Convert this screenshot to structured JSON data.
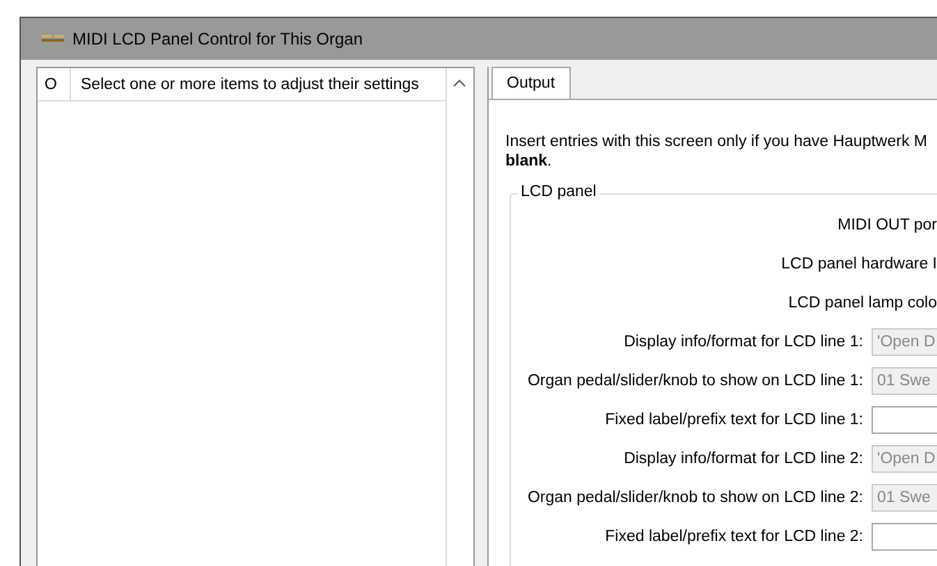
{
  "window": {
    "title": "MIDI LCD Panel Control for This Organ"
  },
  "item_list": {
    "columns": [
      "O",
      "Select one or more items to adjust their settings"
    ]
  },
  "tabs": [
    {
      "label": "Output",
      "selected": true
    }
  ],
  "intro": [
    "Insert entries with this screen only if you have Hauptwerk M",
    "**blank**."
  ],
  "group": {
    "title": "LCD panel",
    "rows": [
      {
        "label": "MIDI OUT por",
        "kind": "cut"
      },
      {
        "label": "LCD panel hardware I",
        "kind": "cut"
      },
      {
        "label": "LCD panel lamp colo",
        "kind": "cut"
      },
      {
        "label": "Display info/format for LCD line 1:",
        "kind": "dropdown",
        "value": "'Open D"
      },
      {
        "label": "Organ pedal/slider/knob to show on LCD line 1:",
        "kind": "dropdown",
        "value": "01 Swe"
      },
      {
        "label": "Fixed label/prefix text for LCD line 1:",
        "kind": "text"
      },
      {
        "label": "Display info/format for LCD line 2:",
        "kind": "dropdown",
        "value": "'Open D"
      },
      {
        "label": "Organ pedal/slider/knob to show on LCD line 2:",
        "kind": "dropdown",
        "value": "01 Swe"
      },
      {
        "label": "Fixed label/prefix text for LCD line 2:",
        "kind": "text"
      }
    ]
  }
}
